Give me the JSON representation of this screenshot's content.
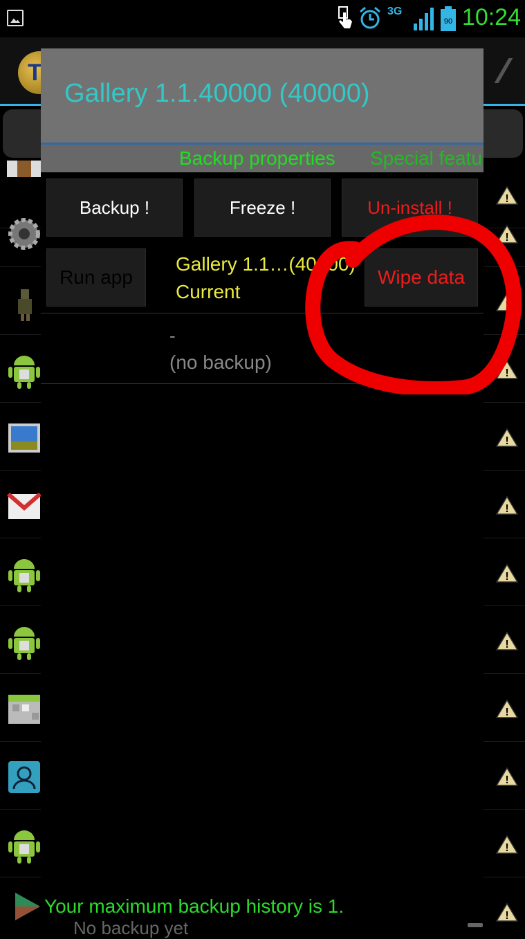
{
  "status_bar": {
    "network_label": "3G",
    "battery_level": "90",
    "time": "10:24"
  },
  "dialog": {
    "title": "Gallery 1.1.40000 (40000)",
    "tabs": [
      {
        "label": "Backup properties"
      },
      {
        "label": "Special featu"
      }
    ],
    "buttons": {
      "backup": "Backup !",
      "freeze": "Freeze !",
      "uninstall": "Un-install !",
      "run_app": "Run app",
      "wipe_data": "Wipe data"
    },
    "current_version": {
      "name": "Gallery 1.1…(40000)",
      "status": "Current"
    },
    "backup_entry": {
      "dash": "-",
      "text": "(no backup)"
    }
  },
  "footer": {
    "message": "Your maximum backup history is 1.",
    "sub_text": "No backup yet"
  },
  "colors": {
    "accent_blue": "#33b5e5",
    "title_cyan": "#33c8c8",
    "green": "#22dd22",
    "red": "#ee1c1c",
    "yellow": "#eaea3c"
  },
  "background_list_icons": [
    "drink-icon",
    "settings-icon",
    "character-icon",
    "android-icon",
    "gallery-icon",
    "gmail-icon",
    "android-icon",
    "android-icon",
    "calendar-icon",
    "contacts-icon",
    "android-icon",
    "play-icon"
  ]
}
